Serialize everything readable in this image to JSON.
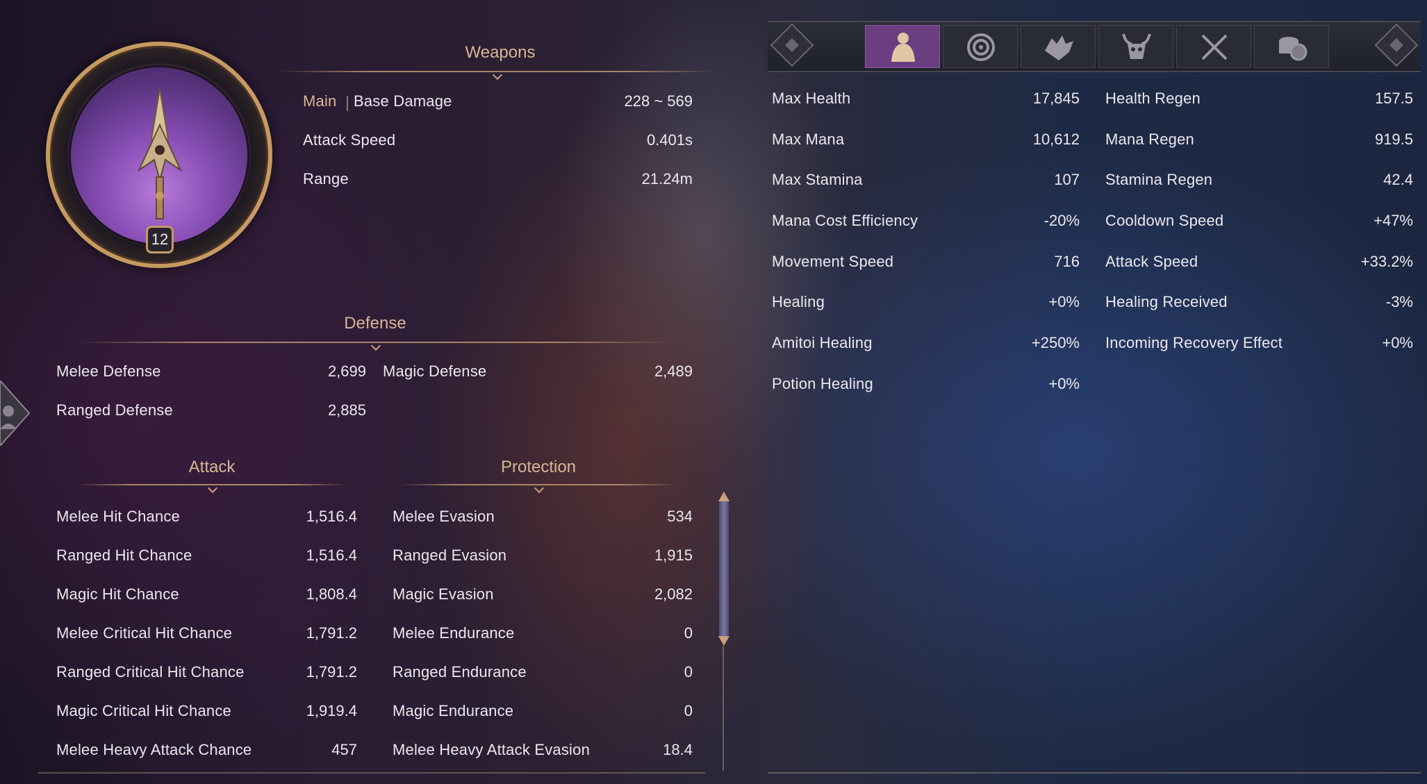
{
  "weapon": {
    "header": "Weapons",
    "level": "12",
    "main_tag": "Main",
    "rows": [
      {
        "label": "Base Damage",
        "value": "228 ~ 569"
      },
      {
        "label": "Attack Speed",
        "value": "0.401s"
      },
      {
        "label": "Range",
        "value": "21.24m"
      }
    ]
  },
  "defense": {
    "header": "Defense",
    "melee_label": "Melee Defense",
    "melee_value": "2,699",
    "magic_label": "Magic Defense",
    "magic_value": "2,489",
    "ranged_label": "Ranged Defense",
    "ranged_value": "2,885"
  },
  "attack": {
    "header": "Attack",
    "rows": [
      {
        "label": "Melee Hit Chance",
        "value": "1,516.4"
      },
      {
        "label": "Ranged Hit Chance",
        "value": "1,516.4"
      },
      {
        "label": "Magic Hit Chance",
        "value": "1,808.4"
      },
      {
        "label": "Melee Critical Hit Chance",
        "value": "1,791.2"
      },
      {
        "label": "Ranged Critical Hit Chance",
        "value": "1,791.2"
      },
      {
        "label": "Magic Critical Hit Chance",
        "value": "1,919.4"
      },
      {
        "label": "Melee Heavy Attack Chance",
        "value": "457"
      }
    ]
  },
  "protection": {
    "header": "Protection",
    "rows": [
      {
        "label": "Melee Evasion",
        "value": "534"
      },
      {
        "label": "Ranged Evasion",
        "value": "1,915"
      },
      {
        "label": "Magic Evasion",
        "value": "2,082"
      },
      {
        "label": "Melee Endurance",
        "value": "0"
      },
      {
        "label": "Ranged Endurance",
        "value": "0"
      },
      {
        "label": "Magic Endurance",
        "value": "0"
      },
      {
        "label": "Melee Heavy Attack Evasion",
        "value": "18.4"
      }
    ]
  },
  "tabs": [
    {
      "icon": "body-icon",
      "active": true
    },
    {
      "icon": "swirl-icon",
      "active": false
    },
    {
      "icon": "beast-icon",
      "active": false
    },
    {
      "icon": "demon-icon",
      "active": false
    },
    {
      "icon": "crossed-swords-icon",
      "active": false
    },
    {
      "icon": "coins-icon",
      "active": false
    }
  ],
  "general_left": [
    {
      "label": "Max Health",
      "value": "17,845"
    },
    {
      "label": "Max Mana",
      "value": "10,612"
    },
    {
      "label": "Max Stamina",
      "value": "107"
    },
    {
      "label": "Mana Cost Efficiency",
      "value": "-20%"
    },
    {
      "label": "Movement Speed",
      "value": "716"
    },
    {
      "label": "Healing",
      "value": "+0%"
    },
    {
      "label": "Amitoi Healing",
      "value": "+250%"
    },
    {
      "label": "Potion Healing",
      "value": "+0%"
    }
  ],
  "general_right": [
    {
      "label": "Health Regen",
      "value": "157.5"
    },
    {
      "label": "Mana Regen",
      "value": "919.5"
    },
    {
      "label": "Stamina Regen",
      "value": "42.4"
    },
    {
      "label": "Cooldown Speed",
      "value": "+47%"
    },
    {
      "label": "Attack Speed",
      "value": "+33.2%"
    },
    {
      "label": "Healing Received",
      "value": "-3%"
    },
    {
      "label": "Incoming Recovery Effect",
      "value": "+0%"
    }
  ],
  "colors": {
    "accent_gold": "#d7b795",
    "active_tab": "#6a3e80",
    "text": "#ece8ee"
  }
}
